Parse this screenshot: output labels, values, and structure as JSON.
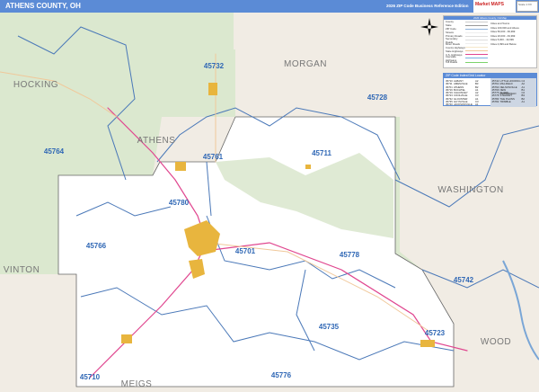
{
  "header": {
    "title": "ATHENS COUNTY, OH",
    "subtitle": "2026 ZIP Code Business Reference Edition",
    "logo_text": "Market MAPS",
    "logo_box": "Scale 1:XX"
  },
  "colors": {
    "header": "#5b8bd6",
    "county": "#ffffff",
    "forest": "#dbe8cf",
    "surrounding": "#f1ece4",
    "zip_label": "#2f67b5",
    "zip_boundary": "#4a78b8",
    "highway_us": "#e0468f",
    "highway_state": "#f0c89a"
  },
  "legend": {
    "title": "2026 Athens County, OH Map",
    "items": [
      "County",
      "State",
      "ZIP Code",
      "Streets",
      "Primary Roads",
      "Secondary Roads",
      "Minor Roads",
      "County Highways",
      "State Highways",
      "U.S. Highways",
      "Interstate Highways",
      "Toll Roads"
    ],
    "city_title": "Cities and Towns",
    "cities": [
      "Cities 100,000 and Above",
      "Cities 50,000 - 99,999",
      "Cities 20,000 - 49,999",
      "Cities 5,000 - 19,999",
      "Cities 4,999 and Below"
    ]
  },
  "index": {
    "title": "ZIP Code Index/Grid Locator",
    "left": [
      [
        "45710",
        "ALBANY",
        "A2"
      ],
      [
        "45711",
        "AMESVILLE",
        "B3"
      ],
      [
        "45701",
        "ATHENS",
        "B2"
      ],
      [
        "45716",
        "BUCHTEL",
        "A1"
      ],
      [
        "45719",
        "CHAUNCEY",
        "A2"
      ],
      [
        "45723",
        "COOLVILLE",
        "C3"
      ],
      [
        "45732",
        "GLOUSTER",
        "A1"
      ],
      [
        "45735",
        "GUYSVILLE",
        "C3"
      ],
      [
        "45740",
        "JACKSONVILLE",
        "A1"
      ]
    ],
    "right": [
      [
        "45742",
        "LITTLE HOCKING",
        "C4"
      ],
      [
        "45761",
        "MILLFIELD",
        "A2"
      ],
      [
        "45764",
        "NELSONVILLE",
        "A1"
      ],
      [
        "45766",
        "NEW MARSHFIELD",
        "B1"
      ],
      [
        "45776",
        "SHADE",
        "C2"
      ],
      [
        "45778",
        "STEWART",
        "B3"
      ],
      [
        "45780",
        "THE PLAINS",
        "B2"
      ],
      [
        "45782",
        "TRIMBLE",
        "A1"
      ]
    ]
  },
  "zips": [
    [
      "45732",
      238,
      62
    ],
    [
      "45728",
      420,
      97
    ],
    [
      "45764",
      60,
      157
    ],
    [
      "45761",
      237,
      163
    ],
    [
      "45711",
      358,
      159
    ],
    [
      "45780",
      199,
      214
    ],
    [
      "45766",
      107,
      262
    ],
    [
      "45701",
      273,
      268
    ],
    [
      "45778",
      389,
      272
    ],
    [
      "45742",
      516,
      300
    ],
    [
      "45735",
      366,
      352
    ],
    [
      "45723",
      484,
      359
    ],
    [
      "45710",
      100,
      408
    ],
    [
      "45776",
      313,
      406
    ]
  ],
  "counties": [
    [
      "HOCKING",
      40,
      97
    ],
    [
      "MORGAN",
      340,
      74
    ],
    [
      "ATHENS",
      174,
      159
    ],
    [
      "WASHINGTON",
      524,
      214
    ],
    [
      "VINTON",
      24,
      303
    ],
    [
      "MEIGS",
      152,
      430
    ],
    [
      "WOOD",
      552,
      383
    ]
  ]
}
